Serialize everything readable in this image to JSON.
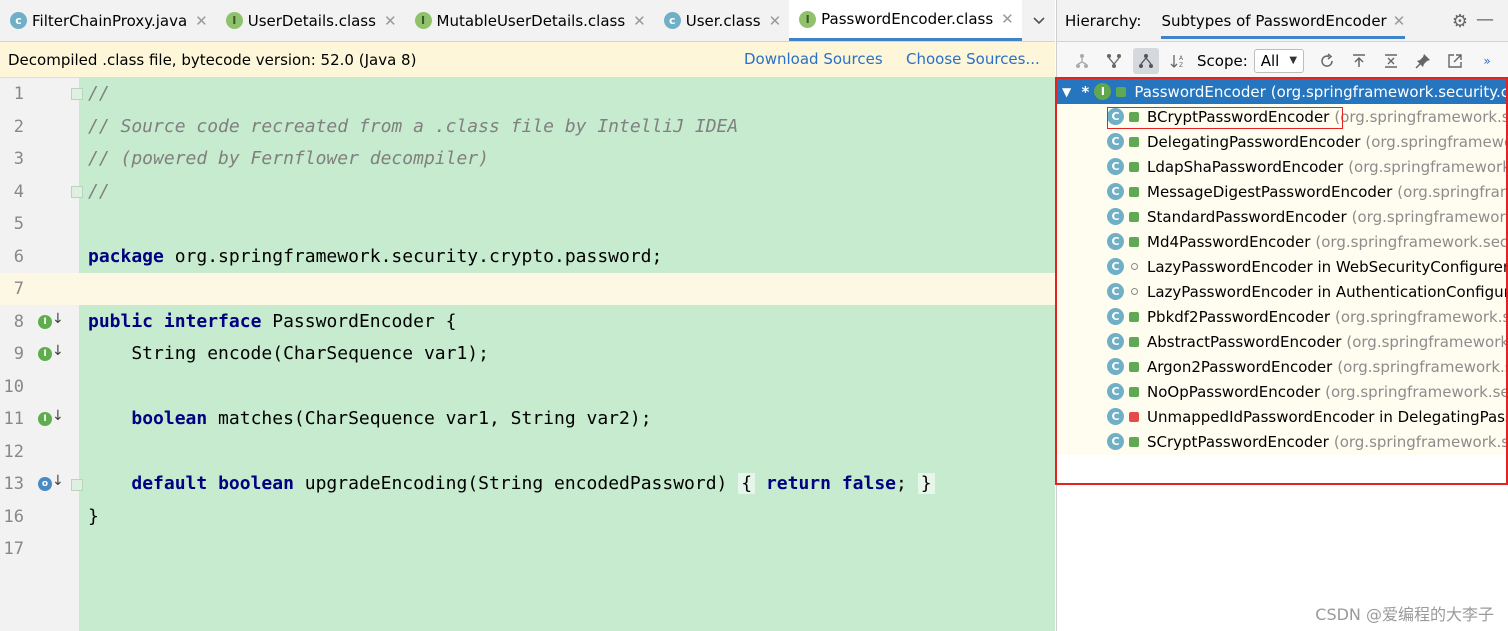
{
  "tabs": [
    {
      "label": "FilterChainProxy.java",
      "icon": "c",
      "kind": "class"
    },
    {
      "label": "UserDetails.class",
      "icon": "I",
      "kind": "interface"
    },
    {
      "label": "MutableUserDetails.class",
      "icon": "I",
      "kind": "interface"
    },
    {
      "label": "User.class",
      "icon": "c",
      "kind": "class"
    },
    {
      "label": "PasswordEncoder.class",
      "icon": "I",
      "kind": "interface",
      "active": true
    }
  ],
  "infobar": {
    "message": "Decompiled .class file, bytecode version: 52.0 (Java 8)",
    "download": "Download Sources",
    "choose": "Choose Sources..."
  },
  "lines": [
    {
      "num": "1"
    },
    {
      "num": "2"
    },
    {
      "num": "3"
    },
    {
      "num": "4"
    },
    {
      "num": "5"
    },
    {
      "num": "6"
    },
    {
      "num": "7"
    },
    {
      "num": "8"
    },
    {
      "num": "9"
    },
    {
      "num": "10"
    },
    {
      "num": "11"
    },
    {
      "num": "12"
    },
    {
      "num": "13"
    },
    {
      "num": "16"
    },
    {
      "num": "17"
    }
  ],
  "code": {
    "c1": "//",
    "c2": "// Source code recreated from a .class file by IntelliJ IDEA",
    "c3": "// (powered by Fernflower decompiler)",
    "c4": "//",
    "pkg_kw": "package",
    "pkg_name": " org.springframework.security.crypto.password;",
    "l8_kw1": "public",
    "l8_kw2": "interface",
    "l8_rest": " PasswordEncoder {",
    "l9": "    String encode(CharSequence var1);",
    "l11_kw": "boolean",
    "l11_rest": " matches(CharSequence var1, String var2);",
    "l13_kw1": "default",
    "l13_kw2": "boolean",
    "l13_rest": " upgradeEncoding(String encodedPassword) ",
    "l13_open": "{",
    "l13_ret": "return",
    "l13_false": "false",
    "l13_semi": ";",
    "l13_close": "}",
    "l16": "}"
  },
  "hierarchy": {
    "label": "Hierarchy:",
    "tab": "Subtypes of PasswordEncoder",
    "scope_label": "Scope:",
    "scope_value": "All",
    "root": {
      "name": "PasswordEncoder",
      "pkg": "(org.springframework.security.c"
    },
    "items": [
      {
        "name": "BCryptPasswordEncoder",
        "pkg": "(org.springframework.se",
        "access": "pub"
      },
      {
        "name": "DelegatingPasswordEncoder",
        "pkg": "(org.springframewo",
        "access": "pub"
      },
      {
        "name": "LdapShaPasswordEncoder",
        "pkg": "(org.springframework.",
        "access": "pub"
      },
      {
        "name": "MessageDigestPasswordEncoder",
        "pkg": "(org.springfram",
        "access": "pub"
      },
      {
        "name": "StandardPasswordEncoder",
        "pkg": "(org.springframework",
        "access": "pub"
      },
      {
        "name": "Md4PasswordEncoder",
        "pkg": "(org.springframework.secu",
        "access": "pub"
      },
      {
        "name": "LazyPasswordEncoder in WebSecurityConfigurerA",
        "pkg": "",
        "access": "pkg"
      },
      {
        "name": "LazyPasswordEncoder in AuthenticationConfigura",
        "pkg": "",
        "access": "pkg"
      },
      {
        "name": "Pbkdf2PasswordEncoder",
        "pkg": "(org.springframework.se",
        "access": "pub"
      },
      {
        "name": "AbstractPasswordEncoder",
        "pkg": "(org.springframework.",
        "access": "pub"
      },
      {
        "name": "Argon2PasswordEncoder",
        "pkg": "(org.springframework.s",
        "access": "pub"
      },
      {
        "name": "NoOpPasswordEncoder",
        "pkg": "(org.springframework.sec",
        "access": "pub"
      },
      {
        "name": "UnmappedIdPasswordEncoder in DelegatingPassw",
        "pkg": "",
        "access": "priv"
      },
      {
        "name": "SCryptPasswordEncoder",
        "pkg": "(org.springframework.se",
        "access": "pub"
      }
    ]
  },
  "watermark": "CSDN @爱编程的大李子",
  "colors": {
    "accent": "#2675bf",
    "highlight_box": "#e32222",
    "code_bg": "#c6ebcf"
  }
}
